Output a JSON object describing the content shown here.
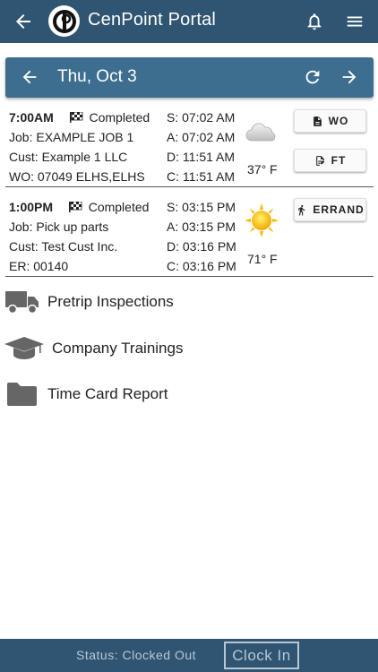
{
  "app": {
    "title": "CenPoint Portal"
  },
  "datebar": {
    "date": "Thu, Oct 3"
  },
  "jobs": [
    {
      "time": "7:00AM",
      "status": "Completed",
      "job": "Job:  EXAMPLE JOB 1",
      "cust": "Cust: Example 1 LLC",
      "ref": "WO: 07049 ELHS,ELHS",
      "s": "S: 07:02 AM",
      "a": "A: 07:02 AM",
      "d": "D: 11:51 AM",
      "c": "C: 11:51 AM",
      "temp": "37° F",
      "weather": "cloudy-icon",
      "buttons": [
        "WO",
        "FT"
      ]
    },
    {
      "time": "1:00PM",
      "status": "Completed",
      "job": "Job:  Pick up parts",
      "cust": "Cust: Test Cust Inc.",
      "ref": "ER: 00140",
      "s": "S: 03:15 PM",
      "a": "A: 03:15 PM",
      "d": "D: 03:16 PM",
      "c": "C: 03:16 PM",
      "temp": "71° F",
      "weather": "sunny-icon",
      "buttons": [
        "ERRAND"
      ]
    }
  ],
  "nav": [
    {
      "label": "Pretrip Inspections",
      "icon": "truck-icon"
    },
    {
      "label": "Company Trainings",
      "icon": "graduation-cap-icon"
    },
    {
      "label": "Time Card Report",
      "icon": "folder-icon"
    }
  ],
  "footer": {
    "status": "Status: Clocked Out",
    "clock_in": "Clock In"
  },
  "colors": {
    "appbar": "#2f5573",
    "datebar": "#3d6e8f",
    "footer_text": "#b8c7d3"
  }
}
